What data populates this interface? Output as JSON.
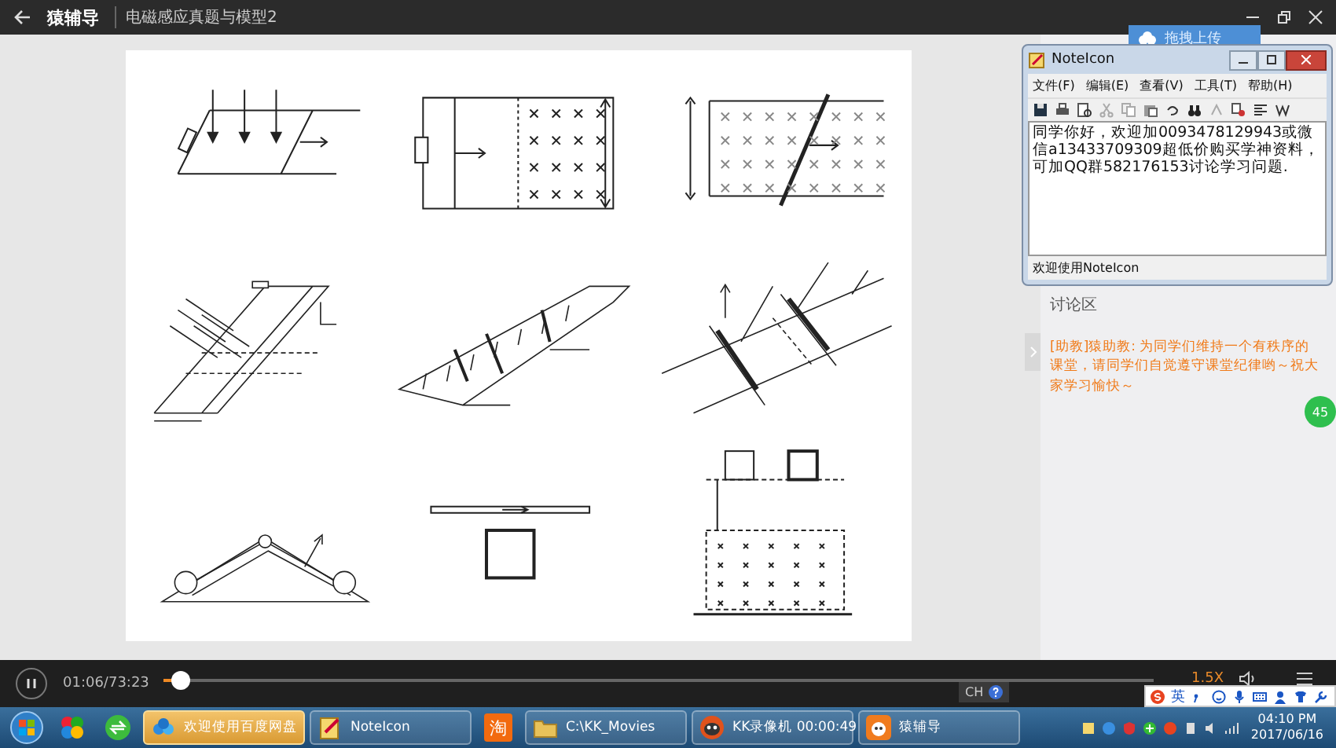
{
  "title_bar": {
    "app_name": "猿辅导",
    "lesson_title": "电磁感应真题与模型2"
  },
  "upload_tab": {
    "label": "拖拽上传"
  },
  "note_window": {
    "title": "NoteIcon",
    "menu": [
      "文件(F)",
      "编辑(E)",
      "查看(V)",
      "工具(T)",
      "帮助(H)"
    ],
    "text": "同学你好，欢迎加0093478129943或微信a13433709309超低价购买学神资料，可加QQ群582176153讨论学习问题.",
    "status": "欢迎使用NoteIcon"
  },
  "discussion": {
    "heading": "讨论区",
    "messages": [
      {
        "text": "[助教]猿助教: 为同学们维持一个有秩序的课堂，请同学们自觉遵守课堂纪律哟～祝大家学习愉快～"
      }
    ],
    "online_badge": "45"
  },
  "player": {
    "playing": true,
    "time": "01:06/73:23",
    "level": 0.018,
    "speed": "1.5X"
  },
  "ime": {
    "indicator": "CH",
    "mode": "英"
  },
  "taskbar": {
    "items": [
      {
        "kind": "task",
        "label": "欢迎使用百度网盘",
        "selected": true
      },
      {
        "kind": "task",
        "label": "NoteIcon",
        "selected": false
      },
      {
        "kind": "pinned",
        "label": "淘",
        "selected": false
      },
      {
        "kind": "task",
        "label": "C:\\KK_Movies",
        "selected": false
      },
      {
        "kind": "task",
        "label": "KK录像机 00:00:49",
        "selected": false
      },
      {
        "kind": "task",
        "label": "猿辅导",
        "selected": false
      }
    ],
    "time": "04:10 PM",
    "date": "2017/06/16"
  }
}
